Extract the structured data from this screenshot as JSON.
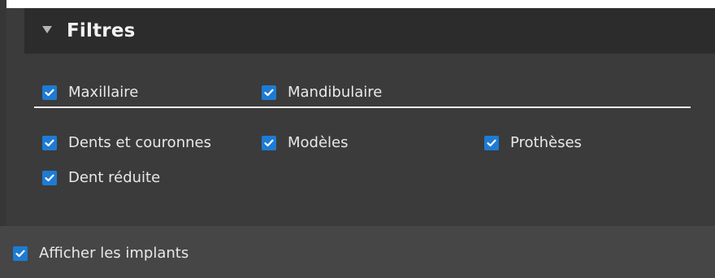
{
  "panel": {
    "title": "Filtres",
    "jaw_filters": [
      {
        "label": "Maxillaire",
        "checked": true
      },
      {
        "label": "Mandibulaire",
        "checked": true
      }
    ],
    "type_filters": [
      {
        "label": "Dents et couronnes",
        "checked": true
      },
      {
        "label": "Modèles",
        "checked": true
      },
      {
        "label": "Prothèses",
        "checked": true
      },
      {
        "label": "Dent réduite",
        "checked": true
      }
    ]
  },
  "footer": {
    "show_implants": {
      "label": "Afficher les implants",
      "checked": true
    }
  },
  "colors": {
    "checkbox_accent": "#1e7bd3",
    "panel_background": "#3b3b3b",
    "header_background": "#2c2c2c",
    "footer_background": "#464646"
  },
  "icons": {
    "collapse": "triangle-down-icon",
    "check": "checkmark-icon"
  }
}
